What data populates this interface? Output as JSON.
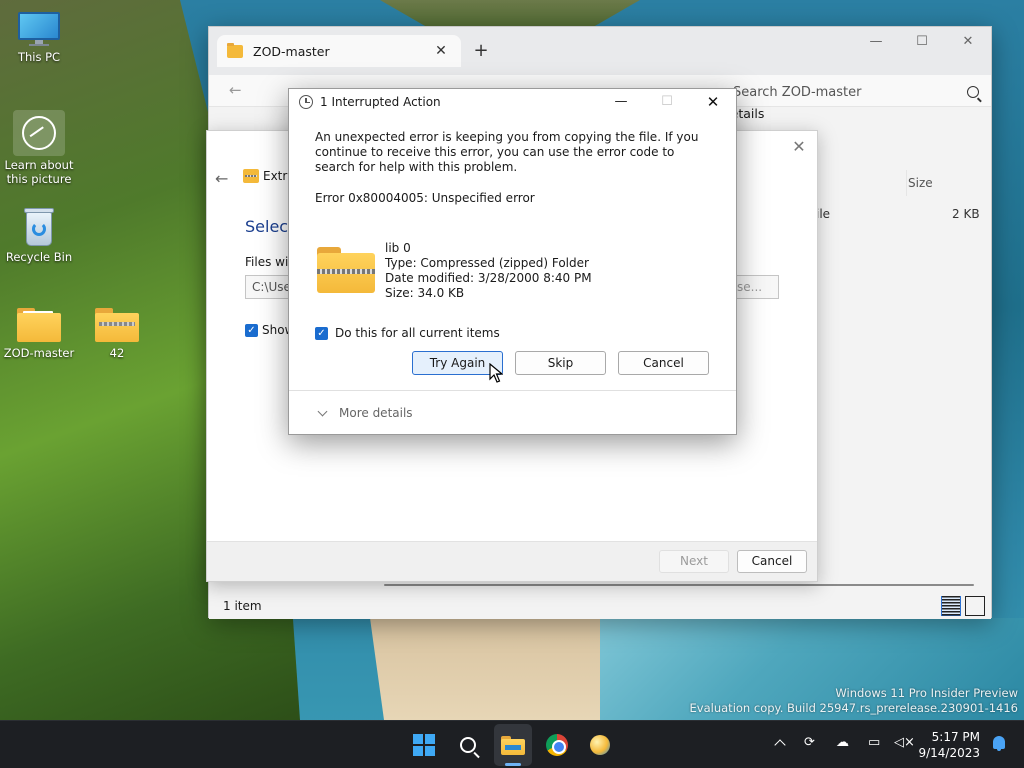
{
  "desktop": {
    "icons": [
      {
        "label": "This PC",
        "icon": "monitor-icon"
      },
      {
        "label": "Learn about this picture",
        "icon": "learn-about-picture-icon"
      },
      {
        "label": "Recycle Bin",
        "icon": "recycle-bin-icon"
      },
      {
        "label": "ZOD-master",
        "icon": "folder-icon"
      },
      {
        "label": "42",
        "icon": "zip-folder-icon"
      }
    ],
    "watermark_line1": "Windows 11 Pro Insider Preview",
    "watermark_line2": "Evaluation copy. Build 25947.rs_prerelease.230901-1416"
  },
  "explorer": {
    "tab_title": "ZOD-master",
    "tab_close": "✕",
    "new_tab": "+",
    "window_controls": [
      "—",
      "☐",
      "✕"
    ],
    "search_placeholder": "Search ZOD-master",
    "details_label": "Details",
    "column_size": "Size",
    "row_type_partial": "ile",
    "row_size": "2 KB",
    "status_items": "1 item",
    "view_modes": [
      "details-view-icon",
      "tiles-view-icon"
    ]
  },
  "wizard": {
    "header_partial": "Extra",
    "heading_partial": "Select",
    "files_label_partial": "Files will",
    "path_partial": "C:\\User",
    "browse_partial": "se...",
    "show_partial": "Show",
    "next_label": "Next",
    "cancel_label": "Cancel",
    "close": "✕",
    "back": "←"
  },
  "dialog": {
    "title": "1 Interrupted Action",
    "controls": {
      "minimize": "—",
      "maximize": "☐",
      "close": "✕"
    },
    "message": "An unexpected error is keeping you from copying the file. If you continue to receive this error, you can use the error code to search for help with this problem.",
    "error": "Error 0x80004005: Unspecified error",
    "file": {
      "name": "lib 0",
      "type": "Type: Compressed (zipped) Folder",
      "modified": "Date modified: 3/28/2000 8:40 PM",
      "size": "Size: 34.0 KB"
    },
    "do_all_label": "Do this for all current items",
    "do_all_checked": true,
    "buttons": {
      "try_again": "Try Again",
      "skip": "Skip",
      "cancel": "Cancel"
    },
    "more_details": "More details"
  },
  "taskbar": {
    "apps": [
      "start-icon",
      "search-icon",
      "file-explorer-icon",
      "chrome-icon",
      "app-orb-icon"
    ],
    "active_app": "file-explorer-icon",
    "time": "5:17 PM",
    "date": "9/14/2023"
  },
  "colors": {
    "accent": "#2a6fd0",
    "checkbox": "#1a6ccf",
    "folder": "#f4b93a",
    "taskbar": "#1d1f23"
  }
}
